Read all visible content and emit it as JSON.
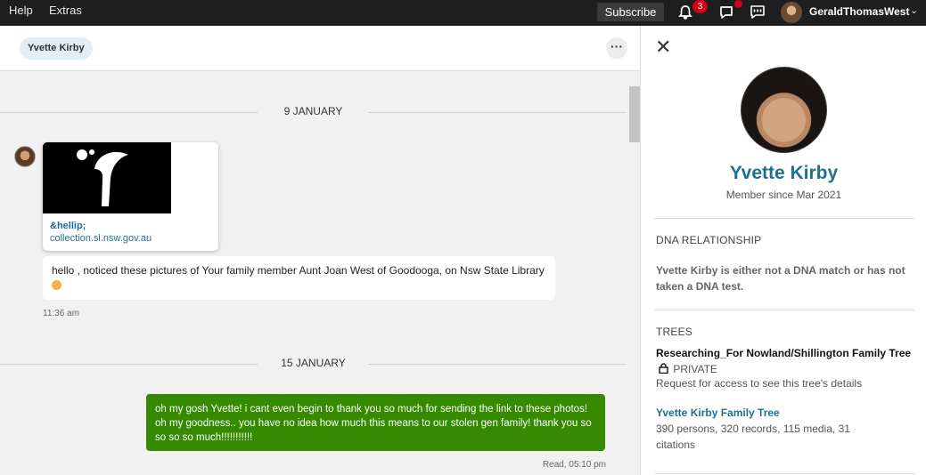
{
  "topbar": {
    "help": "Help",
    "extras": "Extras",
    "subscribe": "Subscribe",
    "notifications_count": "3",
    "username": "GeraldThomasWest",
    "caret": "⌄"
  },
  "conversation": {
    "contact_chip": "Yvette Kirby",
    "more_label": "···",
    "date_1": "9 JANUARY",
    "link_title": "&hellip;",
    "link_url": "collection.sl.nsw.gov.au",
    "message_in": "hello , noticed these pictures of Your family member Aunt Joan West of Goodooga, on Nsw State Library",
    "time_in": "11:36 am",
    "date_2": "15 JANUARY",
    "message_out": "oh my gosh Yvette! i cant even begin to thank you so much for sending the link to these photos! oh my goodness.. you have no idea how much this means to our stolen gen family! thank you so so so so much!!!!!!!!!!!",
    "time_out": "Read, 05:10 pm"
  },
  "profile": {
    "close": "✕",
    "name": "Yvette Kirby",
    "member_since": "Member since Mar 2021",
    "dna_title": "DNA RELATIONSHIP",
    "dna_text": "Yvette Kirby is either not a DNA match or has not taken a DNA test.",
    "trees_title": "TREES",
    "tree1_name": "Researching_For Nowland/Shillington Family Tree",
    "tree1_private": "PRIVATE",
    "tree1_note": "Request for access to see this tree's details",
    "tree2_name": "Yvette Kirby Family Tree",
    "tree2_stats": "390 persons, 320 records, 115 media, 31 citations"
  },
  "colors": {
    "topbar": "#1e1e1e",
    "link": "#1f6f95",
    "outgoing_bubble": "#358a00",
    "badge": "#d0021b"
  },
  "icons": [
    "bell-icon",
    "chat-bubble-icon",
    "message-icon",
    "close-icon",
    "lock-icon",
    "more-icon",
    "emoji-icon"
  ]
}
